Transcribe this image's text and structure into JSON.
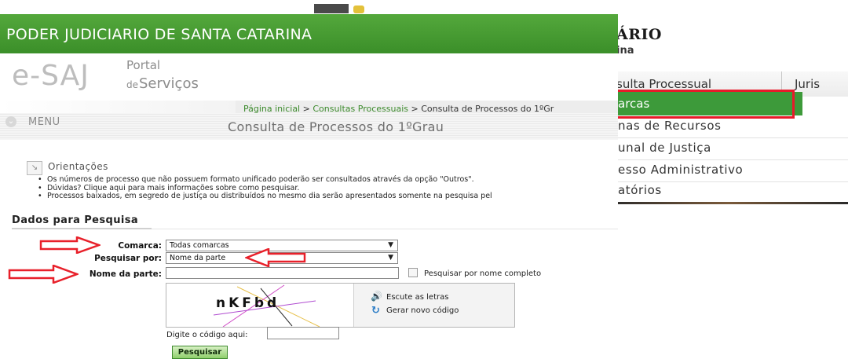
{
  "background_page": {
    "title_line1": "ÁRIO",
    "title_line2": "ina",
    "nav": {
      "item1": "sulta Processual",
      "item2": "Juris"
    },
    "dropdown": {
      "active": "arcas",
      "items": [
        "nas de Recursos",
        "unal de Justiça",
        "esso Administrativo",
        "atórios"
      ]
    },
    "highlight_color": "#e81a2a",
    "active_color": "#3d9a3a"
  },
  "header": {
    "title": "PODER JUDICIARIO DE SANTA CATARINA",
    "color": "#45a030"
  },
  "logo": {
    "main": "e-SAJ",
    "portal": "Portal",
    "de": "de",
    "servicos": "Serviços"
  },
  "breadcrumb": {
    "home": "Página inicial",
    "sep": ">",
    "consultas": "Consultas Processuais",
    "current": "Consulta de Processos do 1ºGr"
  },
  "menu": {
    "icon": "chevron-down-icon",
    "label": "MENU"
  },
  "page_title": "Consulta de Processos do 1ºGrau",
  "orientacoes": {
    "label": "Orientações",
    "items": [
      "Os números de processo que não possuem formato unificado poderão ser consultados através da opção \"Outros\".",
      "Dúvidas? Clique aqui para mais informações sobre como pesquisar.",
      "Processos baixados, em segredo de justiça ou distribuídos no mesmo dia serão apresentados somente na pesquisa pel"
    ]
  },
  "form": {
    "section_title": "Dados para Pesquisa",
    "comarca_label": "Comarca:",
    "comarca_value": "Todas comarcas",
    "pesquisar_por_label": "Pesquisar por:",
    "pesquisar_por_value": "Nome da parte",
    "nome_parte_label": "Nome da parte:",
    "nome_parte_value": "",
    "nome_completo_label": "Pesquisar por nome completo",
    "nome_completo_checked": false,
    "captcha": {
      "text": "nKFbd",
      "listen_label": "Escute as letras",
      "refresh_label": "Gerar novo código"
    },
    "code_label": "Digite o código aqui:",
    "code_value": "",
    "submit_label": "Pesquisar"
  },
  "annotation_color": "#e8202a"
}
